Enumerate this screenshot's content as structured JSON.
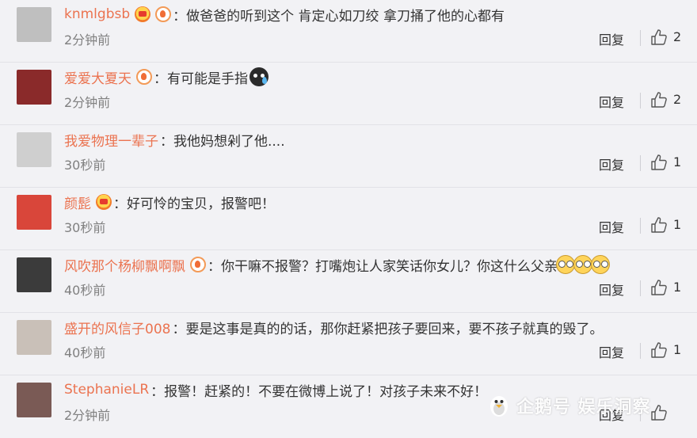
{
  "comments": [
    {
      "user": "knmlgbsb",
      "badges": [
        "vip-icon",
        "level-icon"
      ],
      "text": "：做爸爸的听到这个 肯定心如刀绞  拿刀捅了他的心都有",
      "time": "2分钟前",
      "reply": "回复",
      "likes": "2",
      "avatar_color": "#bfbfbf"
    },
    {
      "user": "爱爱大夏天",
      "badges": [
        "level-icon"
      ],
      "text": "：有可能是手指",
      "emoji_after": "sweat-emoji-icon",
      "time": "2分钟前",
      "reply": "回复",
      "likes": "2",
      "avatar_color": "#8a2a2a"
    },
    {
      "user": "我爱物理一辈子",
      "badges": [],
      "text": "：我他妈想剁了他....",
      "time": "30秒前",
      "reply": "回复",
      "likes": "1",
      "avatar_color": "#cfcfcf"
    },
    {
      "user": "颜髭",
      "badges": [
        "vip-icon"
      ],
      "text": "：好可怜的宝贝，报警吧！",
      "time": "30秒前",
      "reply": "回复",
      "likes": "1",
      "avatar_color": "#d9463a"
    },
    {
      "user": "风吹那个杨柳飘啊飘",
      "badges": [
        "level-icon"
      ],
      "text": "：你干嘛不报警？打嘴炮让人家笑话你女儿？你这什么父亲",
      "emoji_after": "shocked-face-emoji-icon",
      "emoji_count": 3,
      "time": "40秒前",
      "reply": "回复",
      "likes": "1",
      "avatar_color": "#3b3b3b"
    },
    {
      "user": "盛开的风信子008",
      "badges": [],
      "text": "：要是这事是真的的话，那你赶紧把孩子要回来，要不孩子就真的毁了。",
      "time": "40秒前",
      "reply": "回复",
      "likes": "1",
      "avatar_color": "#c9c0b8"
    },
    {
      "user": "StephanieLR",
      "badges": [],
      "text": "：报警！赶紧的！不要在微博上说了！对孩子未来不好！",
      "time": "2分钟前",
      "reply": "回复",
      "likes": "",
      "avatar_color": "#7a5a55"
    }
  ],
  "watermark": {
    "text": "企鹅号 娱乐洞察"
  },
  "colors": {
    "username": "#eb7350",
    "time": "#808080",
    "background": "#f2f2f5"
  }
}
